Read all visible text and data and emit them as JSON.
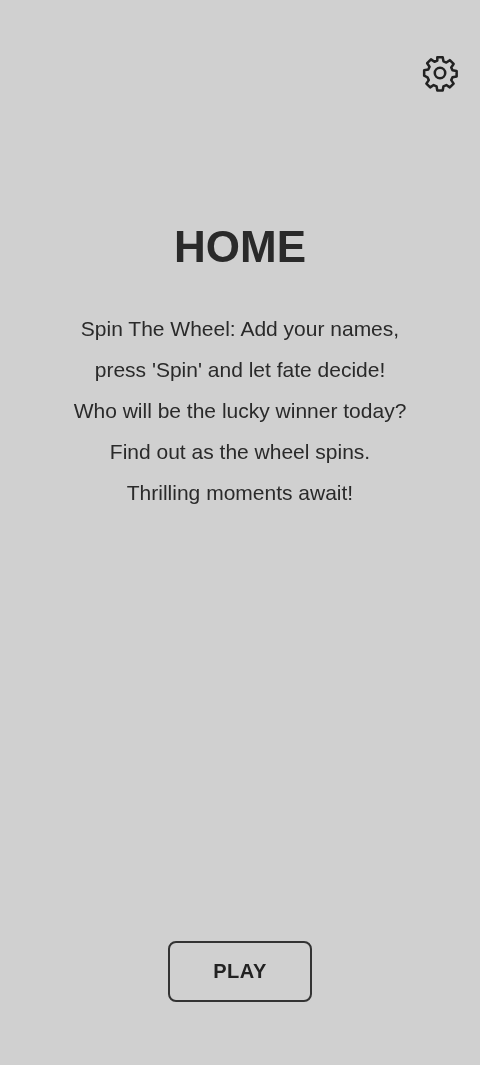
{
  "title": "HOME",
  "description_lines": [
    "Spin The Wheel: Add your names,",
    "press 'Spin' and let fate decide!",
    "Who will be the lucky winner today?",
    "Find out as the wheel spins.",
    "Thrilling moments await!"
  ],
  "play_button": {
    "label": "PLAY"
  }
}
